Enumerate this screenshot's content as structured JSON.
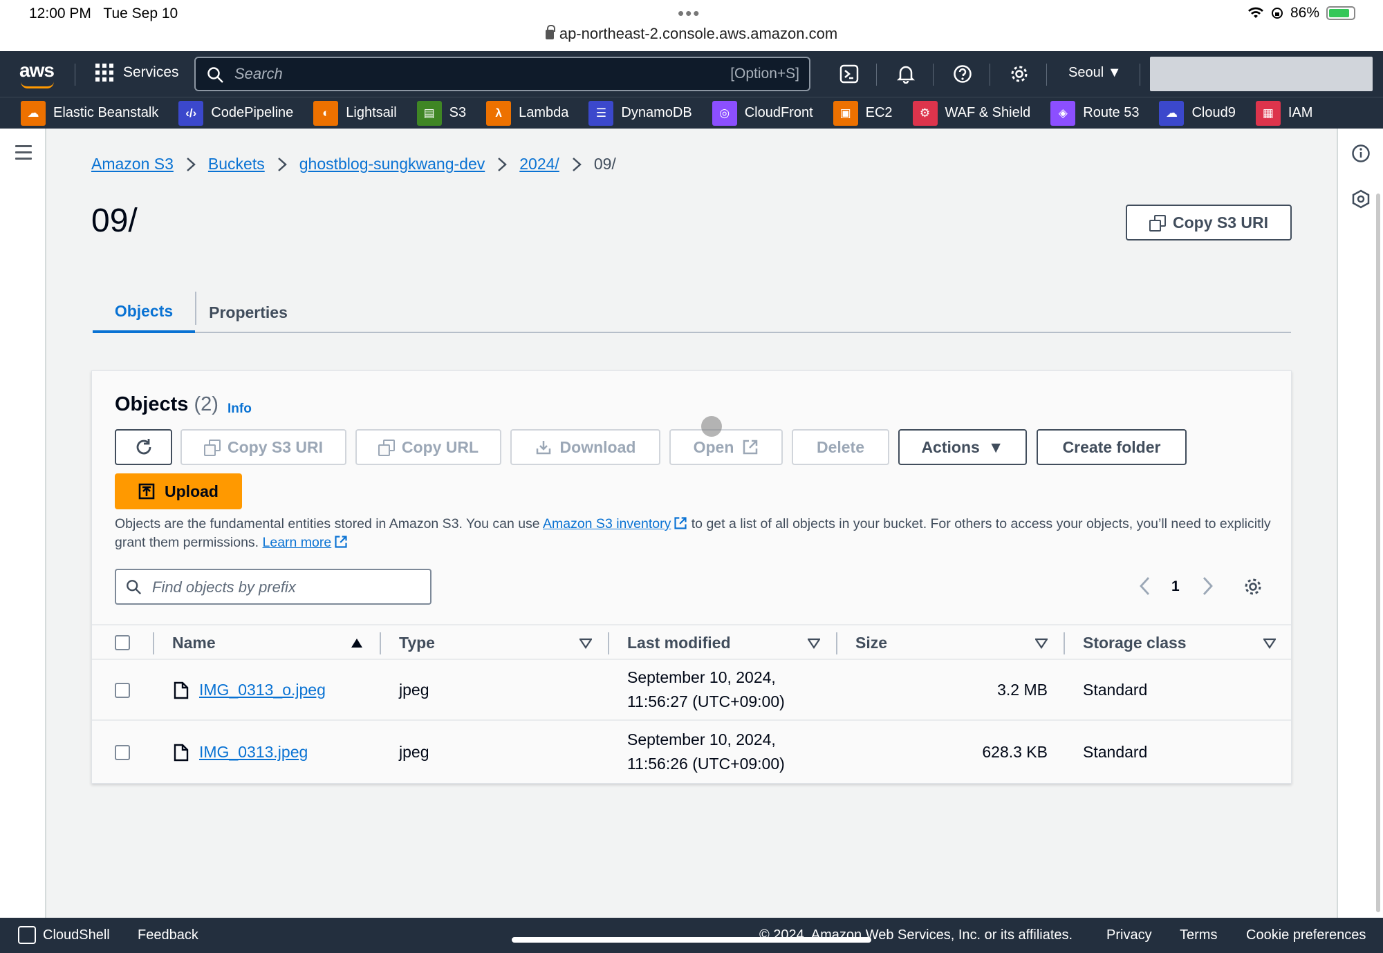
{
  "status_bar": {
    "time": "12:00 PM",
    "date": "Tue Sep 10",
    "url": "ap-northeast-2.console.aws.amazon.com",
    "battery": "86%",
    "battery_level": 0.86
  },
  "topnav": {
    "logo": "aws",
    "services": "Services",
    "search_placeholder": "Search",
    "search_shortcut": "[Option+S]",
    "region": "Seoul"
  },
  "favorites": [
    {
      "label": "Elastic Beanstalk",
      "icon": "beanstalk-icon",
      "color": "#ed7100"
    },
    {
      "label": "CodePipeline",
      "icon": "codepipeline-icon",
      "color": "#3b48cc"
    },
    {
      "label": "Lightsail",
      "icon": "lightsail-icon",
      "color": "#ed7100"
    },
    {
      "label": "S3",
      "icon": "s3-icon",
      "color": "#3f8624"
    },
    {
      "label": "Lambda",
      "icon": "lambda-icon",
      "color": "#ed7100"
    },
    {
      "label": "DynamoDB",
      "icon": "dynamodb-icon",
      "color": "#3b48cc"
    },
    {
      "label": "CloudFront",
      "icon": "cloudfront-icon",
      "color": "#8c4fff"
    },
    {
      "label": "EC2",
      "icon": "ec2-icon",
      "color": "#ed7100"
    },
    {
      "label": "WAF & Shield",
      "icon": "waf-icon",
      "color": "#dd344c"
    },
    {
      "label": "Route 53",
      "icon": "route53-icon",
      "color": "#8c4fff"
    },
    {
      "label": "Cloud9",
      "icon": "cloud9-icon",
      "color": "#3b48cc"
    },
    {
      "label": "IAM",
      "icon": "iam-icon",
      "color": "#dd344c"
    }
  ],
  "breadcrumb": {
    "items": [
      "Amazon S3",
      "Buckets",
      "ghostblog-sungkwang-dev",
      "2024/"
    ],
    "current": "09/"
  },
  "page": {
    "title": "09/",
    "copy_s3_uri": "Copy S3 URI"
  },
  "tabs": [
    "Objects",
    "Properties"
  ],
  "objects_panel": {
    "title": "Objects",
    "count": "(2)",
    "info": "Info",
    "buttons": {
      "copy_s3_uri": "Copy S3 URI",
      "copy_url": "Copy URL",
      "download": "Download",
      "open": "Open",
      "delete": "Delete",
      "actions": "Actions",
      "create_folder": "Create folder",
      "upload": "Upload"
    },
    "description": {
      "part1": "Objects are the fundamental entities stored in Amazon S3. You can use ",
      "inventory_link": "Amazon S3 inventory",
      "part2": " to get a list of all objects in your bucket. For others to access your objects, you’ll need to explicitly grant them permissions. ",
      "learn_more": "Learn more"
    },
    "filter_placeholder": "Find objects by prefix",
    "page_number": "1"
  },
  "table": {
    "columns": [
      "Name",
      "Type",
      "Last modified",
      "Size",
      "Storage class"
    ],
    "rows": [
      {
        "name": "IMG_0313_o.jpeg",
        "type": "jpeg",
        "modified_1": "September 10, 2024,",
        "modified_2": "11:56:27 (UTC+09:00)",
        "size": "3.2 MB",
        "storage": "Standard"
      },
      {
        "name": "IMG_0313.jpeg",
        "type": "jpeg",
        "modified_1": "September 10, 2024,",
        "modified_2": "11:56:26 (UTC+09:00)",
        "size": "628.3 KB",
        "storage": "Standard"
      }
    ]
  },
  "footer": {
    "cloudshell": "CloudShell",
    "feedback": "Feedback",
    "copyright": "© 2024, Amazon Web Services, Inc. or its affiliates.",
    "privacy": "Privacy",
    "terms": "Terms",
    "cookies": "Cookie preferences"
  }
}
